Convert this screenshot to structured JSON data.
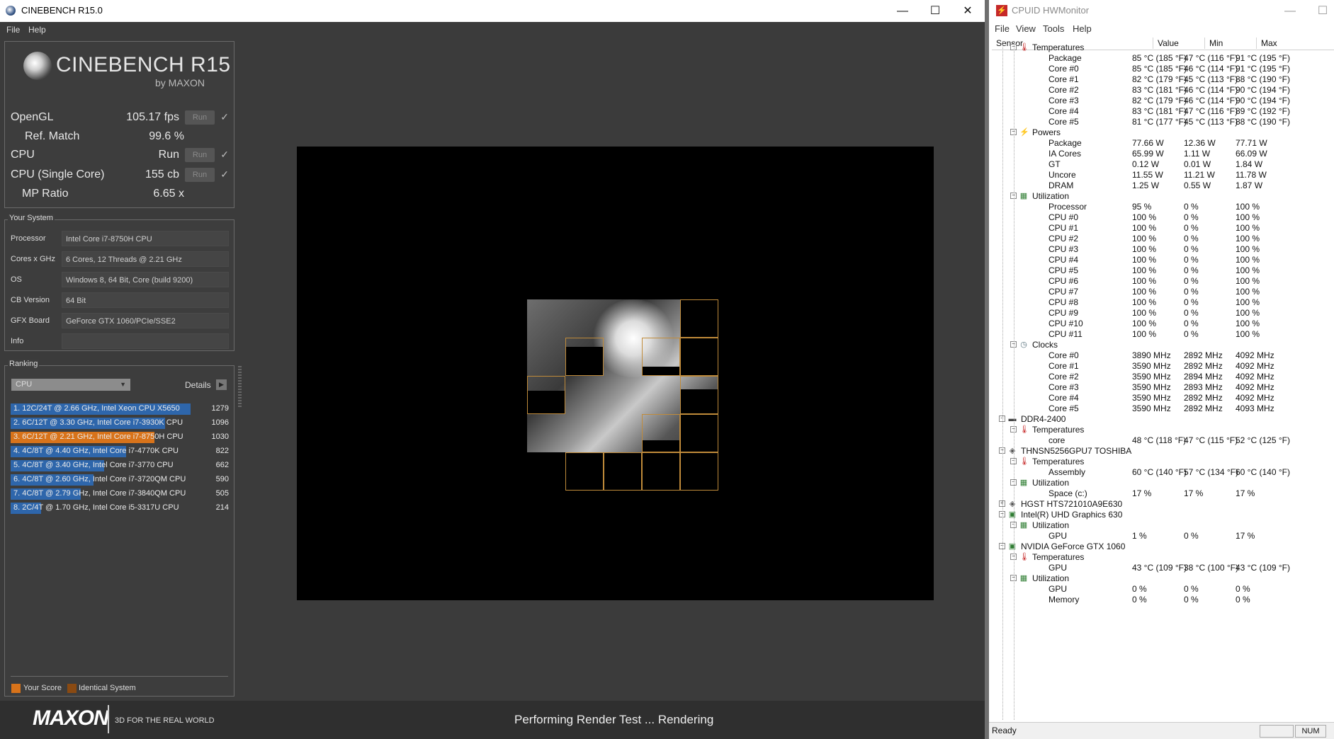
{
  "cinebench": {
    "window_title": "CINEBENCH R15.0",
    "menu": [
      "File",
      "Help"
    ],
    "logo_title": "CINEBENCH R15",
    "logo_sub": "by MAXON",
    "scores": {
      "opengl_label": "OpenGL",
      "opengl_value": "105.17 fps",
      "refmatch_label": "Ref. Match",
      "refmatch_value": "99.6 %",
      "cpu_label": "CPU",
      "cpu_value": "Run",
      "single_label": "CPU (Single Core)",
      "single_value": "155 cb",
      "mp_label": "MP Ratio",
      "mp_value": "6.65 x",
      "run_label": "Run",
      "check": "✓"
    },
    "your_system": {
      "title": "Your System",
      "rows": [
        {
          "label": "Processor",
          "value": "Intel Core i7-8750H CPU"
        },
        {
          "label": "Cores x GHz",
          "value": "6 Cores, 12 Threads @ 2.21 GHz"
        },
        {
          "label": "OS",
          "value": "Windows 8, 64 Bit, Core (build 9200)"
        },
        {
          "label": "CB Version",
          "value": "64 Bit"
        },
        {
          "label": "GFX Board",
          "value": "GeForce GTX 1060/PCIe/SSE2"
        },
        {
          "label": "Info",
          "value": ""
        }
      ]
    },
    "ranking": {
      "title": "Ranking",
      "dropdown": "CPU",
      "details_label": "Details",
      "rows": [
        {
          "text": "1. 12C/24T @ 2.66 GHz, Intel Xeon CPU X5650",
          "score": "1279",
          "fill": 1.0,
          "highlight": false
        },
        {
          "text": "2. 6C/12T @ 3.30 GHz,  Intel Core i7-3930K CPU",
          "score": "1096",
          "fill": 0.86,
          "highlight": false
        },
        {
          "text": "3. 6C/12T @ 2.21 GHz, Intel Core i7-8750H CPU",
          "score": "1030",
          "fill": 0.8,
          "highlight": true
        },
        {
          "text": "4. 4C/8T @ 4.40 GHz, Intel Core i7-4770K CPU",
          "score": "822",
          "fill": 0.64,
          "highlight": false
        },
        {
          "text": "5. 4C/8T @ 3.40 GHz,  Intel Core i7-3770 CPU",
          "score": "662",
          "fill": 0.52,
          "highlight": false
        },
        {
          "text": "6. 4C/8T @ 2.60 GHz, Intel Core i7-3720QM CPU",
          "score": "590",
          "fill": 0.46,
          "highlight": false
        },
        {
          "text": "7. 4C/8T @ 2.79 GHz,  Intel Core i7-3840QM CPU",
          "score": "505",
          "fill": 0.39,
          "highlight": false
        },
        {
          "text": "8. 2C/4T @ 1.70 GHz,  Intel Core i5-3317U CPU",
          "score": "214",
          "fill": 0.17,
          "highlight": false
        }
      ],
      "legend_your_score": "Your Score",
      "legend_identical": "Identical System"
    },
    "footer": {
      "brand": "MAXON",
      "tagline": "3D FOR THE REAL WORLD",
      "status": "Performing Render Test ... Rendering"
    },
    "colors": {
      "bar": "#2e66ab",
      "highlight": "#d8731a",
      "identical": "#8a4a12"
    }
  },
  "hwmonitor": {
    "window_title": "CPUID HWMonitor",
    "menu": [
      "File",
      "View",
      "Tools",
      "Help"
    ],
    "columns": [
      "Sensor",
      "Value",
      "Min",
      "Max"
    ],
    "rows": [
      {
        "level": 2,
        "kind": "group",
        "icon": "thermometer-icon",
        "name": "Temperatures"
      },
      {
        "level": 3,
        "name": "Package",
        "value": "85 °C  (185 °F)",
        "min": "47 °C  (116 °F)",
        "max": "91 °C  (195 °F)"
      },
      {
        "level": 3,
        "name": "Core #0",
        "value": "85 °C  (185 °F)",
        "min": "46 °C  (114 °F)",
        "max": "91 °C  (195 °F)"
      },
      {
        "level": 3,
        "name": "Core #1",
        "value": "82 °C  (179 °F)",
        "min": "45 °C  (113 °F)",
        "max": "88 °C  (190 °F)"
      },
      {
        "level": 3,
        "name": "Core #2",
        "value": "83 °C  (181 °F)",
        "min": "46 °C  (114 °F)",
        "max": "90 °C  (194 °F)"
      },
      {
        "level": 3,
        "name": "Core #3",
        "value": "82 °C  (179 °F)",
        "min": "46 °C  (114 °F)",
        "max": "90 °C  (194 °F)"
      },
      {
        "level": 3,
        "name": "Core #4",
        "value": "83 °C  (181 °F)",
        "min": "47 °C  (116 °F)",
        "max": "89 °C  (192 °F)"
      },
      {
        "level": 3,
        "name": "Core #5",
        "value": "81 °C  (177 °F)",
        "min": "45 °C  (113 °F)",
        "max": "88 °C  (190 °F)"
      },
      {
        "level": 2,
        "kind": "group",
        "icon": "power-icon",
        "name": "Powers"
      },
      {
        "level": 3,
        "name": "Package",
        "value": "77.66 W",
        "min": "12.36 W",
        "max": "77.71 W"
      },
      {
        "level": 3,
        "name": "IA Cores",
        "value": "65.99 W",
        "min": "1.11 W",
        "max": "66.09 W"
      },
      {
        "level": 3,
        "name": "GT",
        "value": "0.12 W",
        "min": "0.01 W",
        "max": "1.84 W"
      },
      {
        "level": 3,
        "name": "Uncore",
        "value": "11.55 W",
        "min": "11.21 W",
        "max": "11.78 W"
      },
      {
        "level": 3,
        "name": "DRAM",
        "value": "1.25 W",
        "min": "0.55 W",
        "max": "1.87 W"
      },
      {
        "level": 2,
        "kind": "group",
        "icon": "utilization-icon",
        "name": "Utilization"
      },
      {
        "level": 3,
        "name": "Processor",
        "value": "95 %",
        "min": "0 %",
        "max": "100 %"
      },
      {
        "level": 3,
        "name": "CPU #0",
        "value": "100 %",
        "min": "0 %",
        "max": "100 %"
      },
      {
        "level": 3,
        "name": "CPU #1",
        "value": "100 %",
        "min": "0 %",
        "max": "100 %"
      },
      {
        "level": 3,
        "name": "CPU #2",
        "value": "100 %",
        "min": "0 %",
        "max": "100 %"
      },
      {
        "level": 3,
        "name": "CPU #3",
        "value": "100 %",
        "min": "0 %",
        "max": "100 %"
      },
      {
        "level": 3,
        "name": "CPU #4",
        "value": "100 %",
        "min": "0 %",
        "max": "100 %"
      },
      {
        "level": 3,
        "name": "CPU #5",
        "value": "100 %",
        "min": "0 %",
        "max": "100 %"
      },
      {
        "level": 3,
        "name": "CPU #6",
        "value": "100 %",
        "min": "0 %",
        "max": "100 %"
      },
      {
        "level": 3,
        "name": "CPU #7",
        "value": "100 %",
        "min": "0 %",
        "max": "100 %"
      },
      {
        "level": 3,
        "name": "CPU #8",
        "value": "100 %",
        "min": "0 %",
        "max": "100 %"
      },
      {
        "level": 3,
        "name": "CPU #9",
        "value": "100 %",
        "min": "0 %",
        "max": "100 %"
      },
      {
        "level": 3,
        "name": "CPU #10",
        "value": "100 %",
        "min": "0 %",
        "max": "100 %"
      },
      {
        "level": 3,
        "name": "CPU #11",
        "value": "100 %",
        "min": "0 %",
        "max": "100 %"
      },
      {
        "level": 2,
        "kind": "group",
        "icon": "clock-icon",
        "name": "Clocks"
      },
      {
        "level": 3,
        "name": "Core #0",
        "value": "3890 MHz",
        "min": "2892 MHz",
        "max": "4092 MHz"
      },
      {
        "level": 3,
        "name": "Core #1",
        "value": "3590 MHz",
        "min": "2892 MHz",
        "max": "4092 MHz"
      },
      {
        "level": 3,
        "name": "Core #2",
        "value": "3590 MHz",
        "min": "2894 MHz",
        "max": "4092 MHz"
      },
      {
        "level": 3,
        "name": "Core #3",
        "value": "3590 MHz",
        "min": "2893 MHz",
        "max": "4092 MHz"
      },
      {
        "level": 3,
        "name": "Core #4",
        "value": "3590 MHz",
        "min": "2892 MHz",
        "max": "4092 MHz"
      },
      {
        "level": 3,
        "name": "Core #5",
        "value": "3590 MHz",
        "min": "2892 MHz",
        "max": "4093 MHz"
      },
      {
        "level": 1,
        "kind": "device",
        "icon": "memory-icon",
        "name": "DDR4-2400"
      },
      {
        "level": 2,
        "kind": "group",
        "icon": "thermometer-icon",
        "name": "Temperatures"
      },
      {
        "level": 3,
        "name": "core",
        "value": "48 °C  (118 °F)",
        "min": "47 °C  (115 °F)",
        "max": "52 °C  (125 °F)"
      },
      {
        "level": 1,
        "kind": "device",
        "icon": "disk-icon",
        "name": "THNSN5256GPU7 TOSHIBA"
      },
      {
        "level": 2,
        "kind": "group",
        "icon": "thermometer-icon",
        "name": "Temperatures"
      },
      {
        "level": 3,
        "name": "Assembly",
        "value": "60 °C  (140 °F)",
        "min": "57 °C  (134 °F)",
        "max": "60 °C  (140 °F)"
      },
      {
        "level": 2,
        "kind": "group",
        "icon": "utilization-icon",
        "name": "Utilization"
      },
      {
        "level": 3,
        "name": "Space (c:)",
        "value": "17 %",
        "min": "17 %",
        "max": "17 %"
      },
      {
        "level": 1,
        "kind": "device",
        "icon": "disk-icon",
        "name": "HGST HTS721010A9E630",
        "collapsed": true
      },
      {
        "level": 1,
        "kind": "device",
        "icon": "gpu-icon",
        "name": "Intel(R) UHD Graphics 630"
      },
      {
        "level": 2,
        "kind": "group",
        "icon": "utilization-icon",
        "name": "Utilization"
      },
      {
        "level": 3,
        "name": "GPU",
        "value": "1 %",
        "min": "0 %",
        "max": "17 %"
      },
      {
        "level": 1,
        "kind": "device",
        "icon": "gpu-icon",
        "name": "NVIDIA GeForce GTX 1060"
      },
      {
        "level": 2,
        "kind": "group",
        "icon": "thermometer-icon",
        "name": "Temperatures"
      },
      {
        "level": 3,
        "name": "GPU",
        "value": "43 °C  (109 °F)",
        "min": "38 °C  (100 °F)",
        "max": "43 °C  (109 °F)"
      },
      {
        "level": 2,
        "kind": "group",
        "icon": "utilization-icon",
        "name": "Utilization"
      },
      {
        "level": 3,
        "name": "GPU",
        "value": "0 %",
        "min": "0 %",
        "max": "0 %"
      },
      {
        "level": 3,
        "name": "Memory",
        "value": "0 %",
        "min": "0 %",
        "max": "0 %"
      }
    ],
    "status": "Ready",
    "num_indicator": "NUM"
  }
}
